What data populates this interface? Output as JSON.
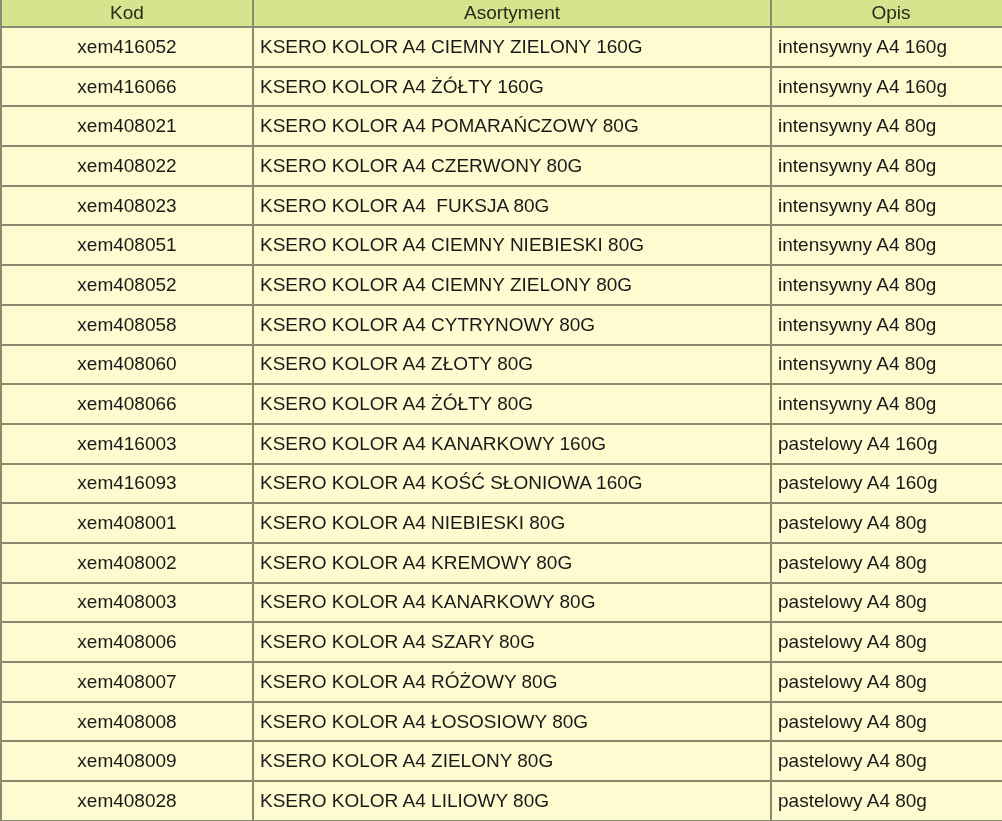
{
  "table": {
    "columns": [
      "Kod",
      "Asortyment",
      "Opis"
    ],
    "rows": [
      [
        "xem416052",
        "KSERO KOLOR A4 CIEMNY ZIELONY 160G",
        "intensywny A4 160g"
      ],
      [
        "xem416066",
        "KSERO KOLOR A4 ŻÓŁTY 160G",
        "intensywny A4 160g"
      ],
      [
        "xem408021",
        "KSERO KOLOR A4 POMARAŃCZOWY 80G",
        "intensywny A4 80g"
      ],
      [
        "xem408022",
        "KSERO KOLOR A4 CZERWONY 80G",
        "intensywny A4 80g"
      ],
      [
        "xem408023",
        "KSERO KOLOR A4  FUKSJA 80G",
        "intensywny A4 80g"
      ],
      [
        "xem408051",
        "KSERO KOLOR A4 CIEMNY NIEBIESKI 80G",
        "intensywny A4 80g"
      ],
      [
        "xem408052",
        "KSERO KOLOR A4 CIEMNY ZIELONY 80G",
        "intensywny A4 80g"
      ],
      [
        "xem408058",
        "KSERO KOLOR A4 CYTRYNOWY 80G",
        "intensywny A4 80g"
      ],
      [
        "xem408060",
        "KSERO KOLOR A4 ZŁOTY 80G",
        "intensywny A4 80g"
      ],
      [
        "xem408066",
        "KSERO KOLOR A4 ŻÓŁTY 80G",
        "intensywny A4 80g"
      ],
      [
        "xem416003",
        "KSERO KOLOR A4 KANARKOWY 160G",
        "pastelowy A4 160g"
      ],
      [
        "xem416093",
        "KSERO KOLOR A4 KOŚĆ SŁONIOWA 160G",
        "pastelowy A4 160g"
      ],
      [
        "xem408001",
        "KSERO KOLOR A4 NIEBIESKI 80G",
        "pastelowy A4 80g"
      ],
      [
        "xem408002",
        "KSERO KOLOR A4 KREMOWY 80G",
        "pastelowy A4 80g"
      ],
      [
        "xem408003",
        "KSERO KOLOR A4 KANARKOWY 80G",
        "pastelowy A4 80g"
      ],
      [
        "xem408006",
        "KSERO KOLOR A4 SZARY 80G",
        "pastelowy A4 80g"
      ],
      [
        "xem408007",
        "KSERO KOLOR A4 RÓŻOWY 80G",
        "pastelowy A4 80g"
      ],
      [
        "xem408008",
        "KSERO KOLOR A4 ŁOSOSIOWY 80G",
        "pastelowy A4 80g"
      ],
      [
        "xem408009",
        "KSERO KOLOR A4 ZIELONY 80G",
        "pastelowy A4 80g"
      ],
      [
        "xem408028",
        "KSERO KOLOR A4 LILIOWY 80G",
        "pastelowy A4 80g"
      ]
    ]
  }
}
